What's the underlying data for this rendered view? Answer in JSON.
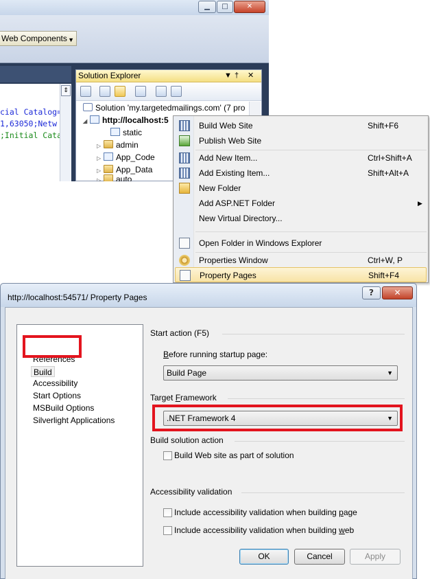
{
  "ide": {
    "toolbox_tab": "Web Components",
    "code_lines": [
      "cial Catalog=",
      "1,63050;Netw",
      ";Initial Cata"
    ]
  },
  "solution_explorer": {
    "title": "Solution Explorer",
    "pin_glyph": "↓",
    "pin2_glyph": "†",
    "close_glyph": "✕",
    "solution_label": "Solution 'my.targetedmailings.com' (7 pro",
    "project_label": "http://localhost:5",
    "items": [
      "static",
      "admin",
      "App_Code",
      "App_Data",
      "auto"
    ]
  },
  "context_menu": {
    "items": [
      {
        "label": "Build Web Site",
        "shortcut": "Shift+F6",
        "icon": "build-icon"
      },
      {
        "label": "Publish Web Site",
        "shortcut": "",
        "icon": "publish-icon"
      },
      {
        "label": "Add New Item...",
        "shortcut": "Ctrl+Shift+A",
        "icon": "add-new-item-icon"
      },
      {
        "label": "Add Existing Item...",
        "shortcut": "Shift+Alt+A",
        "icon": "add-existing-item-icon"
      },
      {
        "label": "New Folder",
        "shortcut": "",
        "icon": "new-folder-icon"
      },
      {
        "label": "Add ASP.NET Folder",
        "shortcut": "",
        "icon": "",
        "submenu": "▶"
      },
      {
        "label": "New Virtual Directory...",
        "shortcut": "",
        "icon": ""
      },
      {
        "label": "Open Folder in Windows Explorer",
        "shortcut": "",
        "icon": "open-folder-icon"
      },
      {
        "label": "Properties Window",
        "shortcut": "Ctrl+W, P",
        "icon": "properties-window-icon"
      },
      {
        "label": "Property Pages",
        "shortcut": "Shift+F4",
        "icon": "property-pages-icon"
      }
    ]
  },
  "dialog": {
    "title": "http://localhost:54571/ Property Pages",
    "help_glyph": "?",
    "close_glyph": "✕",
    "nav": [
      "References",
      "Build",
      "Accessibility",
      "Start Options",
      "MSBuild Options",
      "Silverlight Applications"
    ],
    "start_action_label": "Start action (F5)",
    "before_running_pre": "B",
    "before_running_rest": "efore running startup page:",
    "before_running_value": "Build Page",
    "target_framework_pre": "Target ",
    "target_framework_u": "F",
    "target_framework_post": "ramework",
    "target_framework_value": ".NET Framework 4",
    "build_solution_action": "Build solution action",
    "build_web_site_check": "Build Web site as part of solution",
    "accessibility_validation": "Accessibility validation",
    "acc_page_pre": "Include accessibility validation when building ",
    "acc_page_u": "p",
    "acc_page_post": "age",
    "acc_web_pre": "Include accessibility validation when building ",
    "acc_web_u": "w",
    "acc_web_post": "eb",
    "ok": "OK",
    "cancel": "Cancel",
    "apply": "Apply",
    "combo_arrow": "▼"
  }
}
